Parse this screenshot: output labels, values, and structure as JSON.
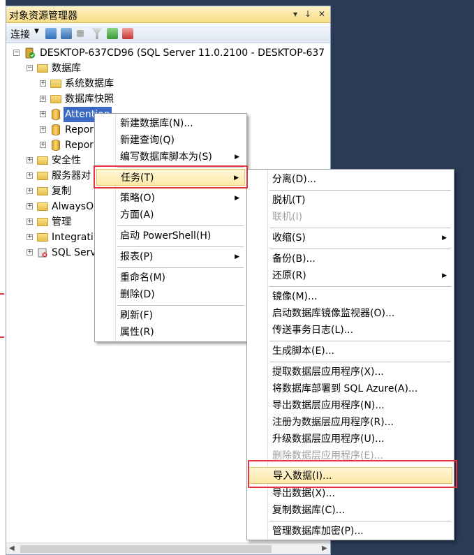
{
  "panel": {
    "title": "对象资源管理器",
    "title_buttons": [
      "▾",
      "↓",
      "✕"
    ],
    "connect_label": "连接"
  },
  "tree": {
    "server": "DESKTOP-637CD96 (SQL Server 11.0.2100 - DESKTOP-637",
    "databases": "数据库",
    "system_databases": "系统数据库",
    "snapshots": "数据库快照",
    "db_attention": "Attention",
    "db_report1": "Repor",
    "db_report2": "Repor",
    "security": "安全性",
    "server_objects": "服务器对",
    "replication": "复制",
    "alwayson": "AlwaysO",
    "management": "管理",
    "integration": "Integrati",
    "sql_server_agent": "SQL Serv"
  },
  "context_menu": {
    "items": {
      "new_database": "新建数据库(N)...",
      "new_query": "新建查询(Q)",
      "script_as": "编写数据库脚本为(S)",
      "tasks": "任务(T)",
      "policies": "策略(O)",
      "facets": "方面(A)",
      "powershell": "启动 PowerShell(H)",
      "reports": "报表(P)",
      "rename": "重命名(M)",
      "delete": "删除(D)",
      "refresh": "刷新(F)",
      "properties": "属性(R)"
    }
  },
  "tasks_menu": {
    "items": {
      "detach": "分离(D)...",
      "offline": "脱机(T)",
      "online": "联机(I)",
      "shrink": "收缩(S)",
      "backup": "备份(B)...",
      "restore": "还原(R)",
      "mirror": "镜像(M)...",
      "mirror_monitor": "启动数据库镜像监视器(O)...",
      "log_shipping": "传送事务日志(L)...",
      "generate_scripts": "生成脚本(E)...",
      "extract_dac": "提取数据层应用程序(X)...",
      "deploy_azure": "将数据库部署到 SQL Azure(A)...",
      "export_dac": "导出数据层应用程序(N)...",
      "register_dac": "注册为数据层应用程序(R)...",
      "upgrade_dac": "升级数据层应用程序(U)...",
      "delete_dac": "删除数据层应用程序(E)...",
      "import_data": "导入数据(I)...",
      "export_data": "导出数据(X)...",
      "copy_database": "复制数据库(C)...",
      "manage_encryption": "管理数据库加密(P)..."
    }
  },
  "submenu_arrow": "▶"
}
